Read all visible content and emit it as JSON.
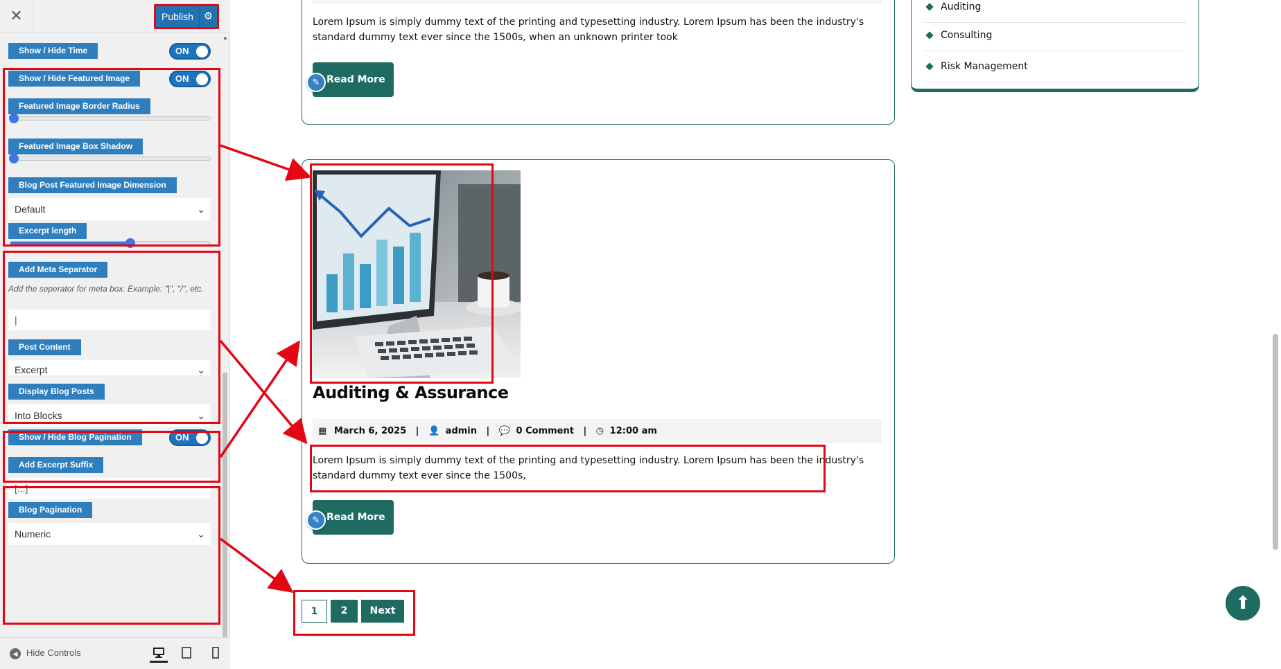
{
  "header": {
    "close_icon": "close-icon",
    "publish_label": "Publish",
    "settings_icon": "gear-icon"
  },
  "controls": {
    "show_hide_time": {
      "label": "Show / Hide Time",
      "toggle": "ON"
    },
    "show_hide_featured_image": {
      "label": "Show / Hide Featured Image",
      "toggle": "ON"
    },
    "featured_image_border_radius": {
      "label": "Featured Image Border Radius",
      "value_fraction": 0.0
    },
    "featured_image_box_shadow": {
      "label": "Featured Image Box Shadow",
      "value_fraction": 0.0
    },
    "featured_image_dimension": {
      "label": "Blog Post Featured Image Dimension",
      "selected": "Default"
    },
    "excerpt_length": {
      "label": "Excerpt length",
      "value_fraction": 0.5
    },
    "meta_separator": {
      "label": "Add Meta Separator",
      "help": "Add the seperator for meta box. Example: \"|\", \"/\", etc.",
      "value": "|"
    },
    "post_content": {
      "label": "Post Content",
      "selected": "Excerpt"
    },
    "display_blog_posts": {
      "label": "Display Blog Posts",
      "selected": "Into Blocks"
    },
    "show_hide_blog_pagination": {
      "label": "Show / Hide Blog Pagination",
      "toggle": "ON"
    },
    "excerpt_suffix": {
      "label": "Add Excerpt Suffix",
      "value": "[...]"
    },
    "blog_pagination": {
      "label": "Blog Pagination",
      "selected": "Numeric"
    }
  },
  "footer": {
    "hide_controls_label": "Hide Controls",
    "devices": [
      "desktop-icon",
      "tablet-icon",
      "mobile-icon"
    ]
  },
  "preview": {
    "post1": {
      "excerpt": "Lorem Ipsum is simply dummy text of the printing and typesetting industry. Lorem Ipsum has been the industry's standard dummy text ever since the 1500s, when an unknown printer took",
      "read_more": "Read More"
    },
    "post2": {
      "title": "Auditing & Assurance",
      "date": "March 6, 2025",
      "author": "admin",
      "comments": "0 Comment",
      "time": "12:00 am",
      "separator": "|",
      "excerpt": "Lorem Ipsum is simply dummy text of the printing and typesetting industry. Lorem Ipsum has been the industry's standard dummy text ever since the 1500s,",
      "read_more": "Read More"
    },
    "categories": [
      "Auditing",
      "Consulting",
      "Risk Management"
    ],
    "pagination": {
      "pages": [
        "1",
        "2"
      ],
      "current": "1",
      "next": "Next"
    }
  },
  "colors": {
    "accent_green": "#1f6b61",
    "wp_blue": "#2271b1",
    "annotation_red": "#e30613"
  }
}
